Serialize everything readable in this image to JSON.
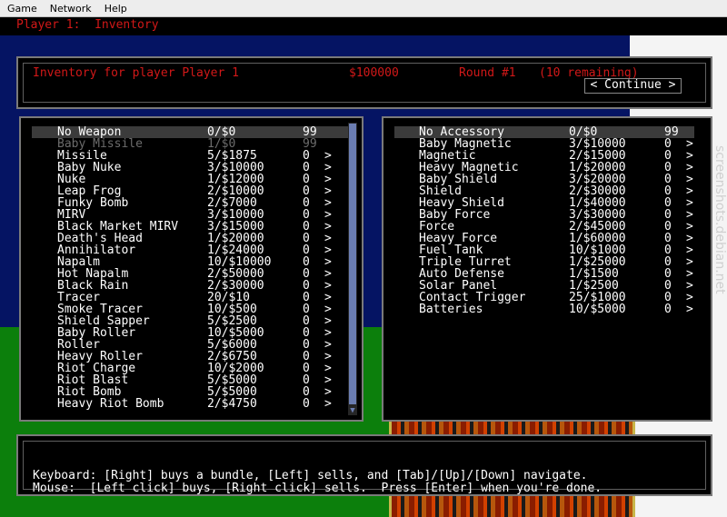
{
  "menu": [
    "Game",
    "Network",
    "Help"
  ],
  "header": {
    "title": "Player 1:  Inventory"
  },
  "info": {
    "label": "Inventory for player Player 1",
    "cash": "$100000",
    "round": "Round #1",
    "remaining": "(10 remaining)",
    "continue_label": "< Continue >"
  },
  "weapons": [
    {
      "name": "No Weapon",
      "price": "0/$0",
      "qty": "99",
      "buy": ""
    },
    {
      "name": "Baby Missile",
      "price": "1/$0",
      "qty": "99",
      "buy": ""
    },
    {
      "name": "Missile",
      "price": "5/$1875",
      "qty": "0",
      "buy": ">"
    },
    {
      "name": "Baby Nuke",
      "price": "3/$10000",
      "qty": "0",
      "buy": ">"
    },
    {
      "name": "Nuke",
      "price": "1/$12000",
      "qty": "0",
      "buy": ">"
    },
    {
      "name": "Leap Frog",
      "price": "2/$10000",
      "qty": "0",
      "buy": ">"
    },
    {
      "name": "Funky Bomb",
      "price": "2/$7000",
      "qty": "0",
      "buy": ">"
    },
    {
      "name": "MIRV",
      "price": "3/$10000",
      "qty": "0",
      "buy": ">"
    },
    {
      "name": "Black Market MIRV",
      "price": "3/$15000",
      "qty": "0",
      "buy": ">"
    },
    {
      "name": "Death's Head",
      "price": "1/$20000",
      "qty": "0",
      "buy": ">"
    },
    {
      "name": "Annihilator",
      "price": "1/$24000",
      "qty": "0",
      "buy": ">"
    },
    {
      "name": "Napalm",
      "price": "10/$10000",
      "qty": "0",
      "buy": ">"
    },
    {
      "name": "Hot Napalm",
      "price": "2/$50000",
      "qty": "0",
      "buy": ">"
    },
    {
      "name": "Black Rain",
      "price": "2/$30000",
      "qty": "0",
      "buy": ">"
    },
    {
      "name": "Tracer",
      "price": "20/$10",
      "qty": "0",
      "buy": ">"
    },
    {
      "name": "Smoke Tracer",
      "price": "10/$500",
      "qty": "0",
      "buy": ">"
    },
    {
      "name": "Shield Sapper",
      "price": "5/$2500",
      "qty": "0",
      "buy": ">"
    },
    {
      "name": "Baby Roller",
      "price": "10/$5000",
      "qty": "0",
      "buy": ">"
    },
    {
      "name": "Roller",
      "price": "5/$6000",
      "qty": "0",
      "buy": ">"
    },
    {
      "name": "Heavy Roller",
      "price": "2/$6750",
      "qty": "0",
      "buy": ">"
    },
    {
      "name": "Riot Charge",
      "price": "10/$2000",
      "qty": "0",
      "buy": ">"
    },
    {
      "name": "Riot Blast",
      "price": "5/$5000",
      "qty": "0",
      "buy": ">"
    },
    {
      "name": "Riot Bomb",
      "price": "5/$5000",
      "qty": "0",
      "buy": ">"
    },
    {
      "name": "Heavy Riot Bomb",
      "price": "2/$4750",
      "qty": "0",
      "buy": ">"
    }
  ],
  "accessories": [
    {
      "name": "No Accessory",
      "price": "0/$0",
      "qty": "99",
      "buy": ""
    },
    {
      "name": "Baby Magnetic",
      "price": "3/$10000",
      "qty": "0",
      "buy": ">"
    },
    {
      "name": "Magnetic",
      "price": "2/$15000",
      "qty": "0",
      "buy": ">"
    },
    {
      "name": "Heavy Magnetic",
      "price": "1/$20000",
      "qty": "0",
      "buy": ">"
    },
    {
      "name": "Baby Shield",
      "price": "3/$20000",
      "qty": "0",
      "buy": ">"
    },
    {
      "name": "Shield",
      "price": "2/$30000",
      "qty": "0",
      "buy": ">"
    },
    {
      "name": "Heavy Shield",
      "price": "1/$40000",
      "qty": "0",
      "buy": ">"
    },
    {
      "name": "Baby Force",
      "price": "3/$30000",
      "qty": "0",
      "buy": ">"
    },
    {
      "name": "Force",
      "price": "2/$45000",
      "qty": "0",
      "buy": ">"
    },
    {
      "name": "Heavy Force",
      "price": "1/$60000",
      "qty": "0",
      "buy": ">"
    },
    {
      "name": "Fuel Tank",
      "price": "10/$1000",
      "qty": "0",
      "buy": ">"
    },
    {
      "name": "Triple Turret",
      "price": "1/$25000",
      "qty": "0",
      "buy": ">"
    },
    {
      "name": "Auto Defense",
      "price": "1/$1500",
      "qty": "0",
      "buy": ">"
    },
    {
      "name": "Solar Panel",
      "price": "1/$2500",
      "qty": "0",
      "buy": ">"
    },
    {
      "name": "Contact Trigger",
      "price": "25/$1000",
      "qty": "0",
      "buy": ">"
    },
    {
      "name": "Batteries",
      "price": "10/$5000",
      "qty": "0",
      "buy": ">"
    }
  ],
  "help": {
    "line1": "Keyboard: [Right] buys a bundle, [Left] sells, and [Tab]/[Up]/[Down] navigate.",
    "line2": "Mouse:  [Left click] buys, [Right click] sells.  Press [Enter] when you're done."
  },
  "watermark": "screenshots.debian.net",
  "colors": {
    "red_text": "#d21818",
    "sky": "#051463",
    "land": "#0c7f0c"
  }
}
